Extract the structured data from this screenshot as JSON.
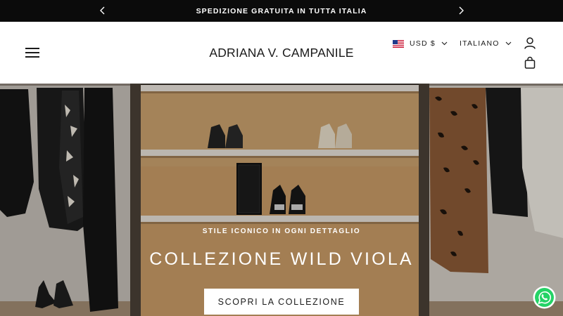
{
  "announcement": {
    "text": "SPEDIZIONE GRATUITA IN TUTTA ITALIA",
    "prev_icon": "chevron-left-icon",
    "next_icon": "chevron-right-icon"
  },
  "header": {
    "logo": "ADRIANA V. CAMPANILE",
    "menu_icon": "hamburger-menu-icon",
    "currency": {
      "label": "USD $",
      "flag": "us-flag-icon"
    },
    "language": {
      "label": "ITALIANO"
    },
    "account_icon": "user-icon",
    "cart_icon": "shopping-bag-icon"
  },
  "hero": {
    "subtitle": "STILE ICONICO IN OGNI DETTAGLIO",
    "title": "COLLEZIONE WILD VIOLA",
    "button_label": "SCOPRI LA COLLEZIONE"
  },
  "floating": {
    "whatsapp_icon": "whatsapp-icon"
  },
  "colors": {
    "announcement_bg": "#0b0b0b",
    "header_bg": "#ffffff",
    "text": "#1a1a1a",
    "shelf_wood": "#c89a63",
    "whatsapp_green": "#25d366"
  }
}
